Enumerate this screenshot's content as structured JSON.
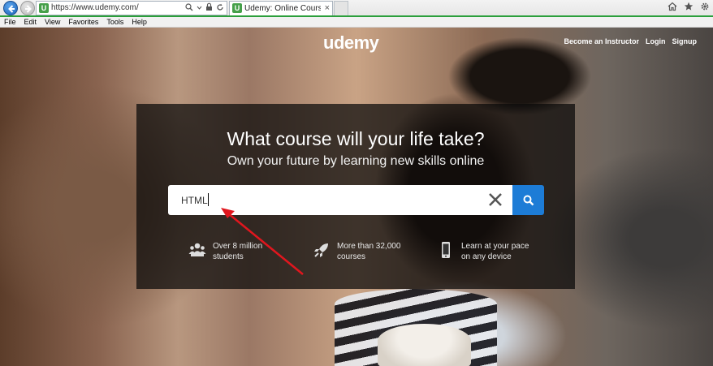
{
  "browser": {
    "url": "https://www.udemy.com/",
    "tab_title": "Udemy: Online Courses An...",
    "tab_close": "×",
    "favicon_letter": "U",
    "menu": [
      "File",
      "Edit",
      "View",
      "Favorites",
      "Tools",
      "Help"
    ]
  },
  "site": {
    "logo": "udemy",
    "nav": [
      "Become an Instructor",
      "Login",
      "Signup"
    ]
  },
  "hero": {
    "headline": "What course will your life take?",
    "subhead": "Own your future by learning new skills online",
    "search_value": "HTML",
    "features": [
      {
        "icon": "users-icon",
        "line1": "Over 8 million",
        "line2": "students"
      },
      {
        "icon": "rocket-icon",
        "line1": "More than 32,000",
        "line2": "courses"
      },
      {
        "icon": "mobile-icon",
        "line1": "Learn at your pace",
        "line2": "on any device"
      }
    ]
  },
  "colors": {
    "accent": "#1d7cd6",
    "arrow": "#e0161e",
    "tab_green": "#2b9f3b"
  }
}
